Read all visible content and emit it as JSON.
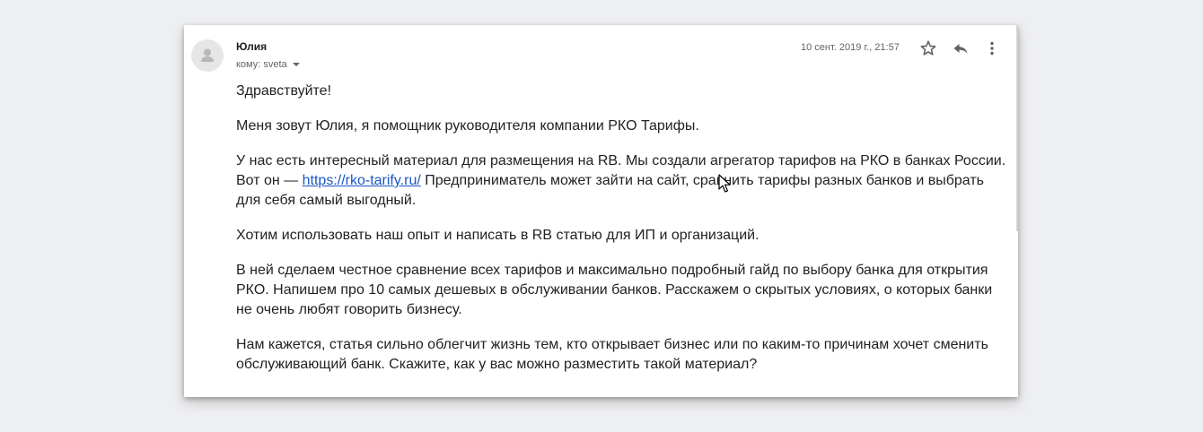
{
  "email": {
    "sender_name": "Юлия",
    "recipient_label": "кому: sveta",
    "date": "10 сент. 2019 г., 21:57",
    "icons": {
      "avatar": "person-avatar-icon",
      "star": "star-icon",
      "reply": "reply-icon",
      "more": "more-vertical-icon",
      "dropdown": "chevron-down-icon"
    },
    "body": {
      "greeting": "Здравствуйте!",
      "intro": "Меня зовут Юлия, я помощник руководителя компании РКО Тарифы.",
      "p3_before_link": "У нас есть интересный материал для размещения на RB. Мы создали агрегатор тарифов на РКО в банках России. Вот он — ",
      "p3_link": "https://rko-tarify.ru/",
      "p3_after_link": " Предприниматель может зайти на сайт, сравнить тарифы разных банков и выбрать для себя самый выгодный.",
      "p4": "Хотим использовать наш опыт и написать в RB статью для ИП и организаций.",
      "p5": "В ней сделаем честное сравнение всех тарифов и максимально подробный гайд по выбору банка для открытия РКО. Напишем про 10 самых дешевых в обслуживании банков. Расскажем о скрытых условиях, о которых банки не очень любят говорить бизнесу.",
      "p6": "Нам кажется, статья сильно облегчит жизнь тем, кто открывает бизнес или по каким-то причинам хочет сменить обслуживающий банк. Скажите, как у вас можно разместить такой материал?"
    }
  },
  "colors": {
    "background": "#eeeff1",
    "card": "#ffffff",
    "link": "#1a57c6",
    "text": "#222222",
    "meta_text": "#5f6368"
  }
}
